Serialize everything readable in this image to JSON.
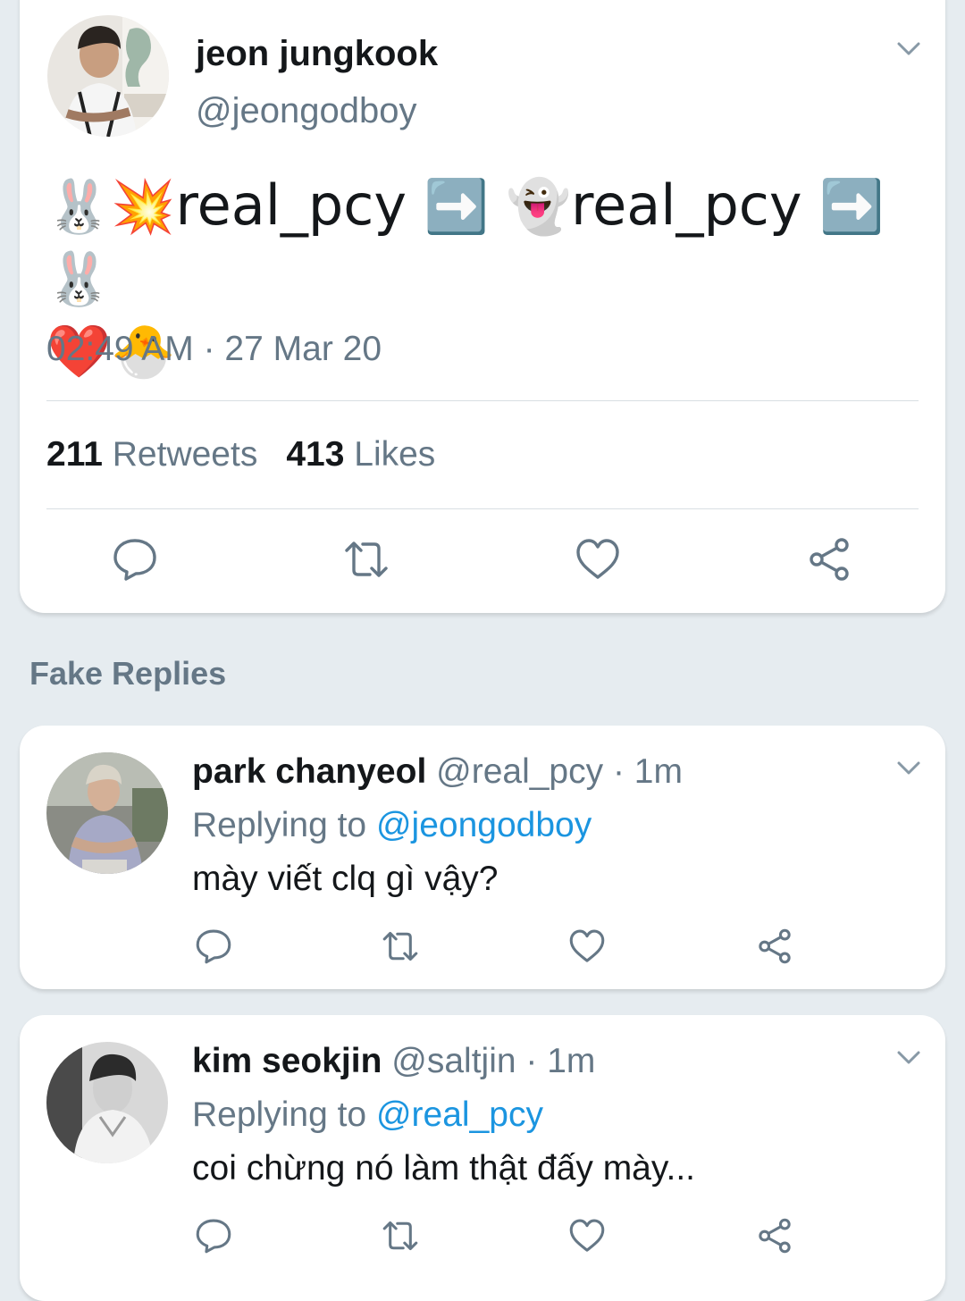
{
  "main_tweet": {
    "author_name": "jeon jungkook",
    "author_handle": "@jeongodboy",
    "text_parts": {
      "e1": "🐰",
      "e2": "💥",
      "t1": "real_pcy",
      "e3": "➡️",
      "e4": "👻",
      "t2": "real_pcy",
      "e5": "➡️",
      "e6": "🐰",
      "e7": "❤️",
      "e8": "🐣"
    },
    "timestamp": "02:49 AM · 27 Mar 20",
    "retweets_count": "211",
    "retweets_label": "Retweets",
    "likes_count": "413",
    "likes_label": "Likes"
  },
  "section_title": "Fake Replies",
  "replies": [
    {
      "author_name": "park chanyeol",
      "meta": "@real_pcy · 1m",
      "replying_prefix": "Replying to",
      "replying_to": "@jeongodboy",
      "text": "mày viết clq gì vậy?"
    },
    {
      "author_name": "kim seokjin",
      "meta": "@saltjin · 1m",
      "replying_prefix": "Replying to",
      "replying_to": "@real_pcy",
      "text": "coi chừng nó làm thật đấy mày..."
    }
  ],
  "icons": {
    "reply": "reply-icon",
    "retweet": "retweet-icon",
    "like": "heart-icon",
    "share": "share-icon",
    "menu": "chevron-down-icon"
  },
  "colors": {
    "background": "#e6ecf0",
    "card": "#ffffff",
    "text_primary": "#14171a",
    "text_secondary": "#657786",
    "link": "#1b95e0",
    "icon": "#657786"
  }
}
